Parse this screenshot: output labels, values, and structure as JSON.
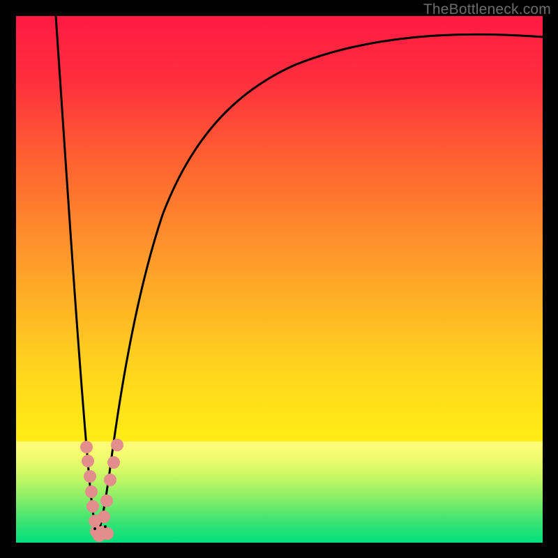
{
  "watermark": "TheBottleneck.com",
  "chart_data": {
    "type": "line",
    "title": "",
    "xlabel": "",
    "ylabel": "",
    "xlim": [
      0,
      100
    ],
    "ylim": [
      0,
      100
    ],
    "background_gradient": {
      "top": "#ff1a42",
      "mid": "#ffd400",
      "green_band_top": "#fffd7a",
      "green_band_bottom": "#00e07a"
    },
    "series": [
      {
        "name": "curve",
        "x_left_top": 7.5,
        "y_left_top": 100,
        "vertex_x": 15.5,
        "vertex_y": 0,
        "right_top_x": 100,
        "right_top_y": 95,
        "note": "Steep V-shaped curve: near-vertical drop from top-left, cusp at ~x=15, rises sharply then asymptotically toward upper right."
      }
    ],
    "markers": {
      "color": "#e38d8d",
      "radius": 9,
      "note": "Cluster of pink circular markers near the bottom cusp along both branches, roughly y in [0,16]."
    }
  }
}
